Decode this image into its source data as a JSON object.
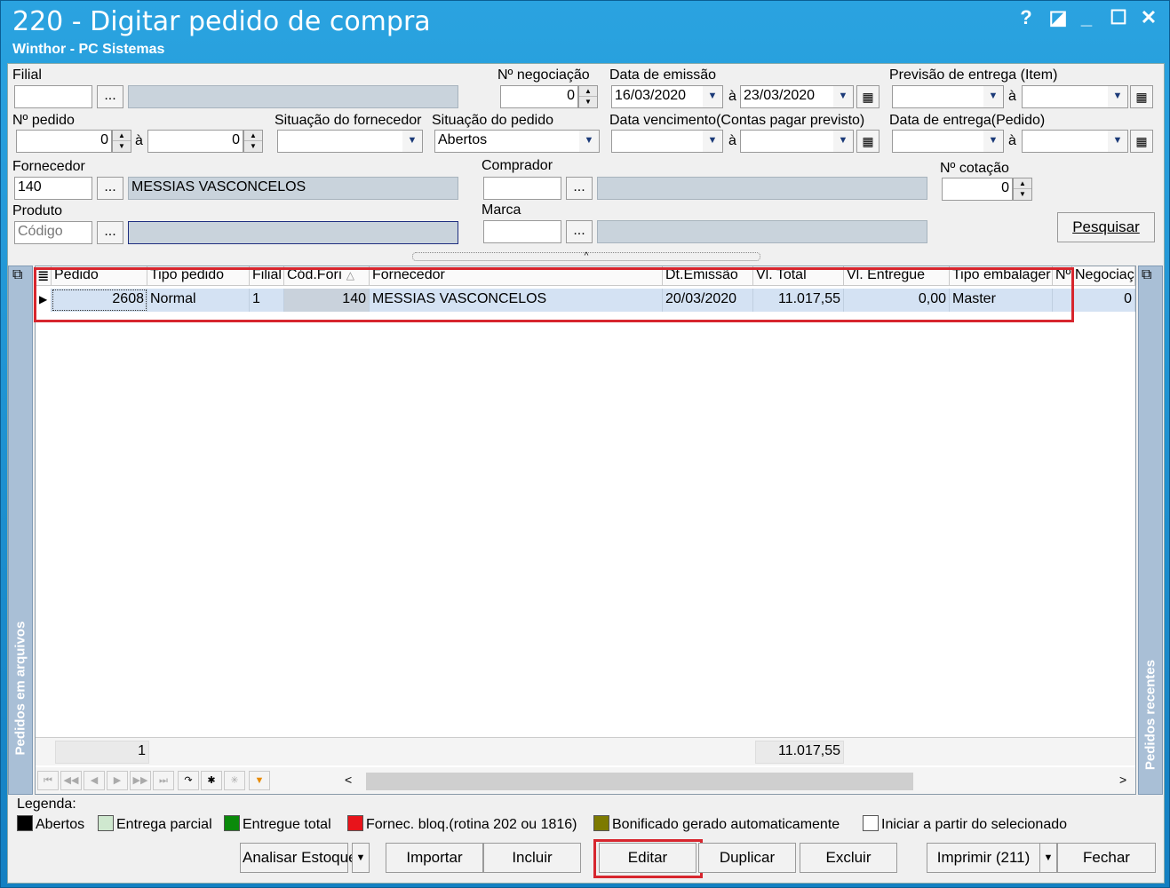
{
  "window": {
    "title": "220 - Digitar pedido de compra",
    "subtitle": "Winthor - PC Sistemas"
  },
  "filters": {
    "filial_label": "Filial",
    "negociacao_label": "Nº negociação",
    "negociacao_value": "0",
    "data_emissao_label": "Data de emissão",
    "data_emissao_de": "16/03/2020",
    "data_emissao_ate": "23/03/2020",
    "previsao_label": "Previsão  de entrega (Item)",
    "pedido_label": "Nº pedido",
    "pedido_de": "0",
    "pedido_ate": "0",
    "sit_fornecedor_label": "Situação do fornecedor",
    "sit_pedido_label": "Situação do pedido",
    "sit_pedido_value": "Abertos",
    "data_venc_label": "Data vencimento(Contas pagar previsto)",
    "data_entrega_label": "Data de entrega(Pedido)",
    "fornecedor_label": "Fornecedor",
    "fornecedor_code": "140",
    "fornecedor_name": "MESSIAS VASCONCELOS",
    "comprador_label": "Comprador",
    "cotacao_label": "Nº cotação",
    "cotacao_value": "0",
    "produto_label": "Produto",
    "produto_placeholder": "Código",
    "marca_label": "Marca",
    "a": "à",
    "dots": "...",
    "pesquisar": "Pesquisar"
  },
  "grid": {
    "columns": [
      "Pedido",
      "Tipo pedido",
      "Filial",
      "Cód.Forı",
      "Fornecedor",
      "Dt.Emissão",
      "Vl. Total",
      "Vl. Entregue",
      "Tipo embalager",
      "Nº",
      "Negociaç"
    ],
    "row": [
      "2608",
      "Normal",
      "1",
      "140",
      "MESSIAS VASCONCELOS",
      "20/03/2020",
      "11.017,55",
      "0,00",
      "Master",
      "",
      "0"
    ],
    "footer_count": "1",
    "footer_total": "11.017,55",
    "side_left": "Pedidos em arquivos",
    "side_right": "Pedidos recentes"
  },
  "legend": {
    "title": "Legenda:",
    "items": [
      {
        "label": "Abertos",
        "color": "#000000"
      },
      {
        "label": "Entrega parcial",
        "color": "#cfe8cf"
      },
      {
        "label": "Entregue total",
        "color": "#0a8a0a"
      },
      {
        "label": "Fornec. bloq.(rotina 202 ou 1816)",
        "color": "#e8141b"
      },
      {
        "label": "Bonificado gerado automaticamente",
        "color": "#7d7a00"
      }
    ],
    "checkbox_label": "Iniciar a partir do selecionado"
  },
  "buttons": {
    "analisar": "Analisar Estoque",
    "importar": "Importar",
    "incluir": "Incluir",
    "editar": "Editar",
    "duplicar": "Duplicar",
    "excluir": "Excluir",
    "imprimir": "Imprimir (211)",
    "fechar": "Fechar"
  }
}
